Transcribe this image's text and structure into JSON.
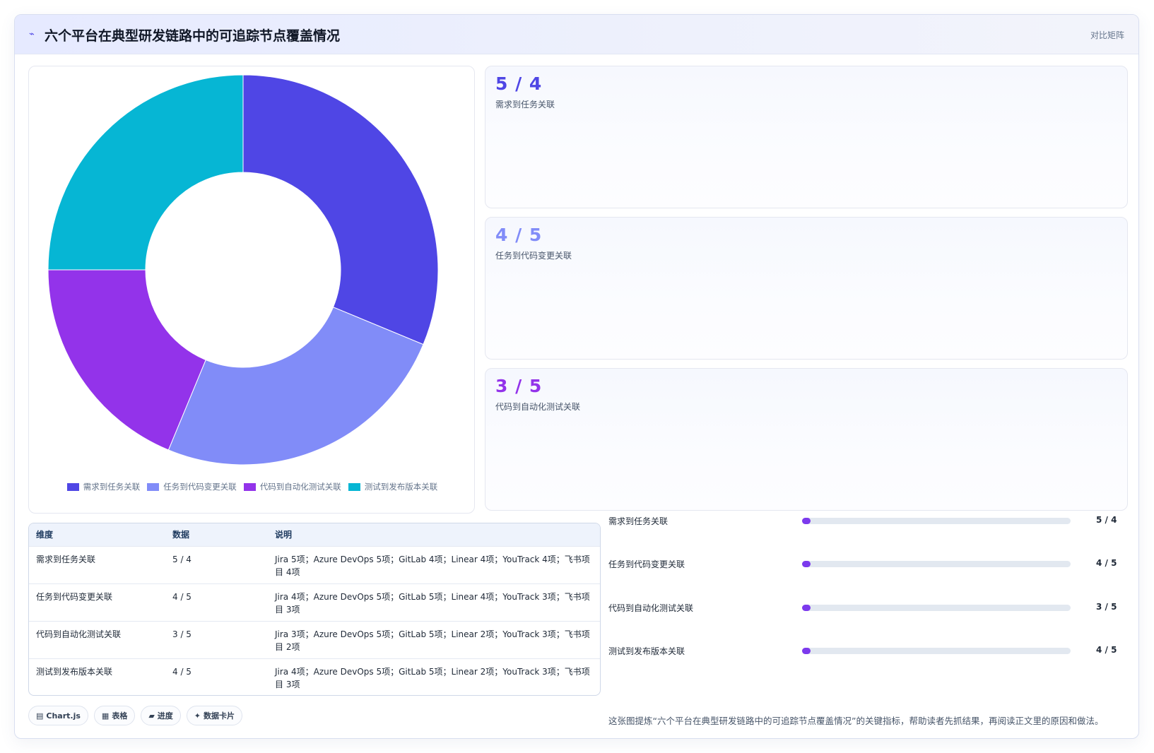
{
  "header": {
    "icon": "chart-icon",
    "title": "六个平台在典型研发链路中的可追踪节点覆盖情况",
    "right_label": "对比矩阵"
  },
  "colors": {
    "series1": "#4f46e5",
    "series2": "#818cf8",
    "series3": "#9333ea",
    "series4": "#06b6d4",
    "bar_fill": "#7c3aed"
  },
  "chart_data": {
    "type": "pie",
    "donut": true,
    "categories": [
      "需求到任务关联",
      "任务到代码变更关联",
      "代码到自动化测试关联",
      "测试到发布版本关联"
    ],
    "values": [
      5,
      4,
      3,
      4
    ],
    "legend_position": "bottom"
  },
  "stats": [
    {
      "value": "5 / 4",
      "label": "需求到任务关联",
      "color": "#4f46e5"
    },
    {
      "value": "4 / 5",
      "label": "任务到代码变更关联",
      "color": "#818cf8"
    },
    {
      "value": "3 / 5",
      "label": "代码到自动化测试关联",
      "color": "#9333ea"
    }
  ],
  "table": {
    "headers": [
      "维度",
      "数据",
      "说明"
    ],
    "rows": [
      [
        "需求到任务关联",
        "5 / 4",
        "Jira 5项；Azure DevOps 5项；GitLab 4项；Linear 4项；YouTrack 4项；飞书项目 4项"
      ],
      [
        "任务到代码变更关联",
        "4 / 5",
        "Jira 4项；Azure DevOps 5项；GitLab 5项；Linear 4项；YouTrack 3项；飞书项目 3项"
      ],
      [
        "代码到自动化测试关联",
        "3 / 5",
        "Jira 3项；Azure DevOps 5项；GitLab 5项；Linear 2项；YouTrack 3项；飞书项目 2项"
      ],
      [
        "测试到发布版本关联",
        "4 / 5",
        "Jira 4项；Azure DevOps 5项；GitLab 5项；Linear 2项；YouTrack 3项；飞书项目 3项"
      ]
    ]
  },
  "tags": [
    {
      "icon": "▤",
      "label": "Chart.js"
    },
    {
      "icon": "▦",
      "label": "表格"
    },
    {
      "icon": "▰",
      "label": "进度"
    },
    {
      "icon": "✦",
      "label": "数据卡片"
    }
  ],
  "bars": [
    {
      "label": "需求到任务关联",
      "value": "5 / 4",
      "fill": 0.02
    },
    {
      "label": "任务到代码变更关联",
      "value": "4 / 5",
      "fill": 0.02
    },
    {
      "label": "代码到自动化测试关联",
      "value": "3 / 5",
      "fill": 0.02
    },
    {
      "label": "测试到发布版本关联",
      "value": "4 / 5",
      "fill": 0.02
    }
  ],
  "footer_note": "这张图提炼“六个平台在典型研发链路中的可追踪节点覆盖情况”的关键指标，帮助读者先抓结果，再阅读正文里的原因和做法。"
}
